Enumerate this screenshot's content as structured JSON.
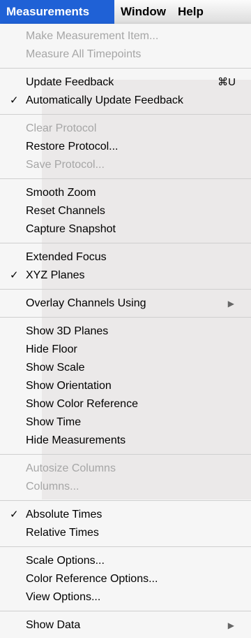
{
  "menubar": {
    "items": [
      {
        "label": "Measurements",
        "active": true
      },
      {
        "label": "Window",
        "active": false
      },
      {
        "label": "Help",
        "active": false
      }
    ]
  },
  "icons": {
    "checkmark": "✓",
    "submenu_arrow": "▶"
  },
  "menu": {
    "groups": [
      [
        {
          "label": "Make Measurement Item...",
          "enabled": false
        },
        {
          "label": "Measure All Timepoints",
          "enabled": false
        }
      ],
      [
        {
          "label": "Update Feedback",
          "enabled": true,
          "shortcut": "⌘U"
        },
        {
          "label": "Automatically Update Feedback",
          "enabled": true,
          "checked": true
        }
      ],
      [
        {
          "label": "Clear Protocol",
          "enabled": false
        },
        {
          "label": "Restore Protocol...",
          "enabled": true
        },
        {
          "label": "Save Protocol...",
          "enabled": false
        }
      ],
      [
        {
          "label": "Smooth Zoom",
          "enabled": true
        },
        {
          "label": "Reset Channels",
          "enabled": true
        },
        {
          "label": "Capture Snapshot",
          "enabled": true
        }
      ],
      [
        {
          "label": "Extended Focus",
          "enabled": true
        },
        {
          "label": "XYZ Planes",
          "enabled": true,
          "checked": true
        }
      ],
      [
        {
          "label": "Overlay Channels Using",
          "enabled": true,
          "submenu": true
        }
      ],
      [
        {
          "label": "Show 3D Planes",
          "enabled": true
        },
        {
          "label": "Hide Floor",
          "enabled": true
        },
        {
          "label": "Show Scale",
          "enabled": true
        },
        {
          "label": "Show Orientation",
          "enabled": true
        },
        {
          "label": "Show Color Reference",
          "enabled": true
        },
        {
          "label": "Show Time",
          "enabled": true
        },
        {
          "label": "Hide Measurements",
          "enabled": true
        }
      ],
      [
        {
          "label": "Autosize Columns",
          "enabled": false
        },
        {
          "label": "Columns...",
          "enabled": false
        }
      ],
      [
        {
          "label": "Absolute Times",
          "enabled": true,
          "checked": true
        },
        {
          "label": "Relative Times",
          "enabled": true
        }
      ],
      [
        {
          "label": "Scale Options...",
          "enabled": true
        },
        {
          "label": "Color Reference Options...",
          "enabled": true
        },
        {
          "label": "View Options...",
          "enabled": true
        }
      ],
      [
        {
          "label": "Show Data",
          "enabled": true,
          "submenu": true
        }
      ]
    ]
  }
}
